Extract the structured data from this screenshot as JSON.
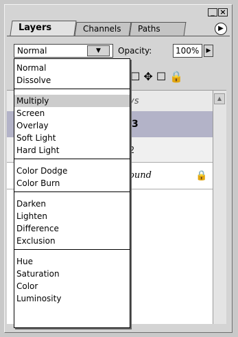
{
  "window": {
    "minimize_label": "_",
    "close_label": "×"
  },
  "tabs": [
    {
      "label": "Layers"
    },
    {
      "label": "Channels"
    },
    {
      "label": "Paths"
    }
  ],
  "panel_menu_glyph": "▶",
  "blend": {
    "value": "Normal",
    "arrow": "▼"
  },
  "opacity": {
    "label": "Opacity:",
    "value": "100%",
    "arrow": "▶"
  },
  "lock_row": {
    "text": "☐  ✥  ☐ 🔒"
  },
  "layers": [
    {
      "name": "ys"
    },
    {
      "name": "3"
    },
    {
      "name": "2"
    },
    {
      "name": "Background",
      "display": "ound",
      "lock_glyph": "🔒"
    }
  ],
  "scroll_up_glyph": "▲",
  "blend_modes": [
    [
      "Normal",
      "Dissolve"
    ],
    [
      "Multiply",
      "Screen",
      "Overlay",
      "Soft Light",
      "Hard Light"
    ],
    [
      "Color Dodge",
      "Color Burn"
    ],
    [
      "Darken",
      "Lighten",
      "Difference",
      "Exclusion"
    ],
    [
      "Hue",
      "Saturation",
      "Color",
      "Luminosity"
    ]
  ],
  "highlighted_mode": "Multiply"
}
